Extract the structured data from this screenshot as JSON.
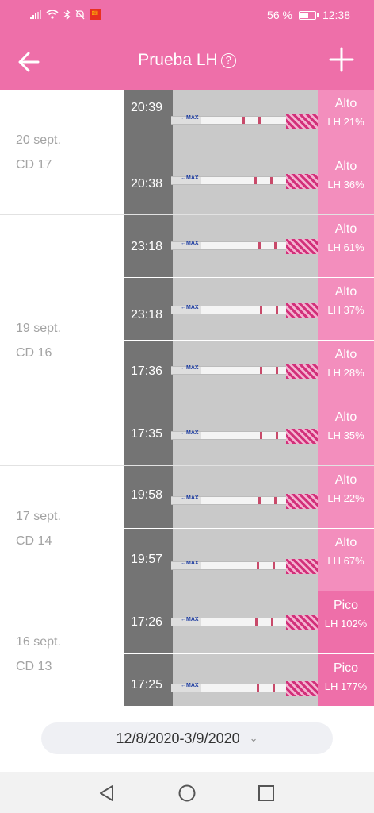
{
  "status": {
    "battery": "56 %",
    "battery_level": 0.56,
    "time": "12:38"
  },
  "header": {
    "title": "Prueba LH",
    "help_icon": "?"
  },
  "groups": [
    {
      "date": "20 sept.",
      "cycle_day": "CD 17",
      "entries": [
        {
          "time": "20:39",
          "level": "Alto",
          "lh": "LH 21%"
        },
        {
          "time": "20:38",
          "level": "Alto",
          "lh": "LH 36%"
        }
      ]
    },
    {
      "date": "19 sept.",
      "cycle_day": "CD 16",
      "entries": [
        {
          "time": "23:18",
          "level": "Alto",
          "lh": "LH 61%"
        },
        {
          "time": "23:18",
          "level": "Alto",
          "lh": "LH 37%"
        },
        {
          "time": "17:36",
          "level": "Alto",
          "lh": "LH 28%"
        },
        {
          "time": "17:35",
          "level": "Alto",
          "lh": "LH 35%"
        }
      ]
    },
    {
      "date": "17 sept.",
      "cycle_day": "CD 14",
      "entries": [
        {
          "time": "19:58",
          "level": "Alto",
          "lh": "LH 22%"
        },
        {
          "time": "19:57",
          "level": "Alto",
          "lh": "LH 67%"
        }
      ]
    },
    {
      "date": "16 sept.",
      "cycle_day": "CD 13",
      "entries": [
        {
          "time": "17:26",
          "level": "Pico",
          "lh": "LH 102%"
        },
        {
          "time": "17:25",
          "level": "Pico",
          "lh": "LH 177%"
        }
      ]
    }
  ],
  "footer": {
    "date_range": "12/8/2020-3/9/2020"
  },
  "strip_max_label": "←MAX",
  "colors": {
    "brand_pink": "#ee6fa9",
    "badge_pink": "#f06eaa",
    "date_text": "#a3a3a3"
  }
}
